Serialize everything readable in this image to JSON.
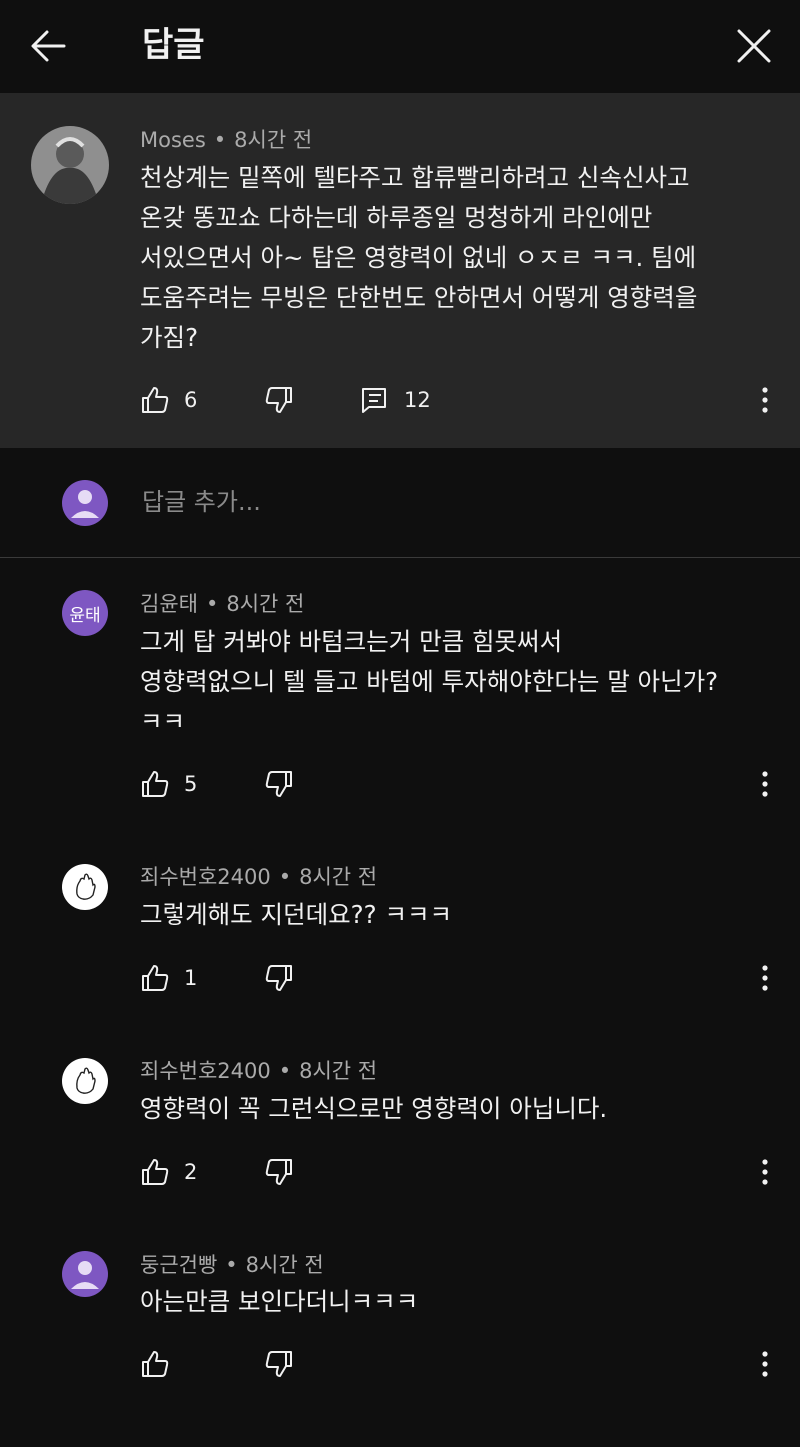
{
  "header": {
    "title": "답글",
    "back_icon": "arrow-left-icon",
    "close_icon": "close-icon"
  },
  "parent_comment": {
    "author": "Moses",
    "time": "8시간 전",
    "text": "천상계는 밑쪽에 텔타주고 합류빨리하려고 신속신사고\n온갖 똥꼬쇼 다하는데 하루종일 멍청하게 라인에만\n서있으면서 아~ 탑은 영향력이 없네 ㅇㅈㄹ ㅋㅋ. 팀에\n도움주려는 무빙은 단한번도 안하면서 어떻게 영향력을\n가짐?",
    "likes": "6",
    "replies": "12"
  },
  "add_reply": {
    "placeholder": "답글 추가..."
  },
  "replies": [
    {
      "author": "김윤태",
      "time": "8시간 전",
      "avatar_initials": "윤태",
      "text": "그게 탑 커봐야 바텀크는거 만큼 힘못써서\n영향력없으니 텔 들고 바텀에 투자해야한다는 말 아닌가?\nㅋㅋ",
      "likes": "5"
    },
    {
      "author": "죄수번호2400",
      "time": "8시간 전",
      "text": "그렇게해도 지던데요?? ㅋㅋㅋ",
      "likes": "1"
    },
    {
      "author": "죄수번호2400",
      "time": "8시간 전",
      "text": "영향력이 꼭 그런식으로만 영향력이 아닙니다.",
      "likes": "2"
    },
    {
      "author": "둥근건빵",
      "time": "8시간 전",
      "text": "아는만큼 보인다더니ㅋㅋㅋ",
      "likes": ""
    }
  ],
  "colors": {
    "background": "#0f0f0f",
    "highlight": "#272727",
    "avatar_purple": "#7e57c2",
    "secondary_text": "#aaaaaa"
  }
}
